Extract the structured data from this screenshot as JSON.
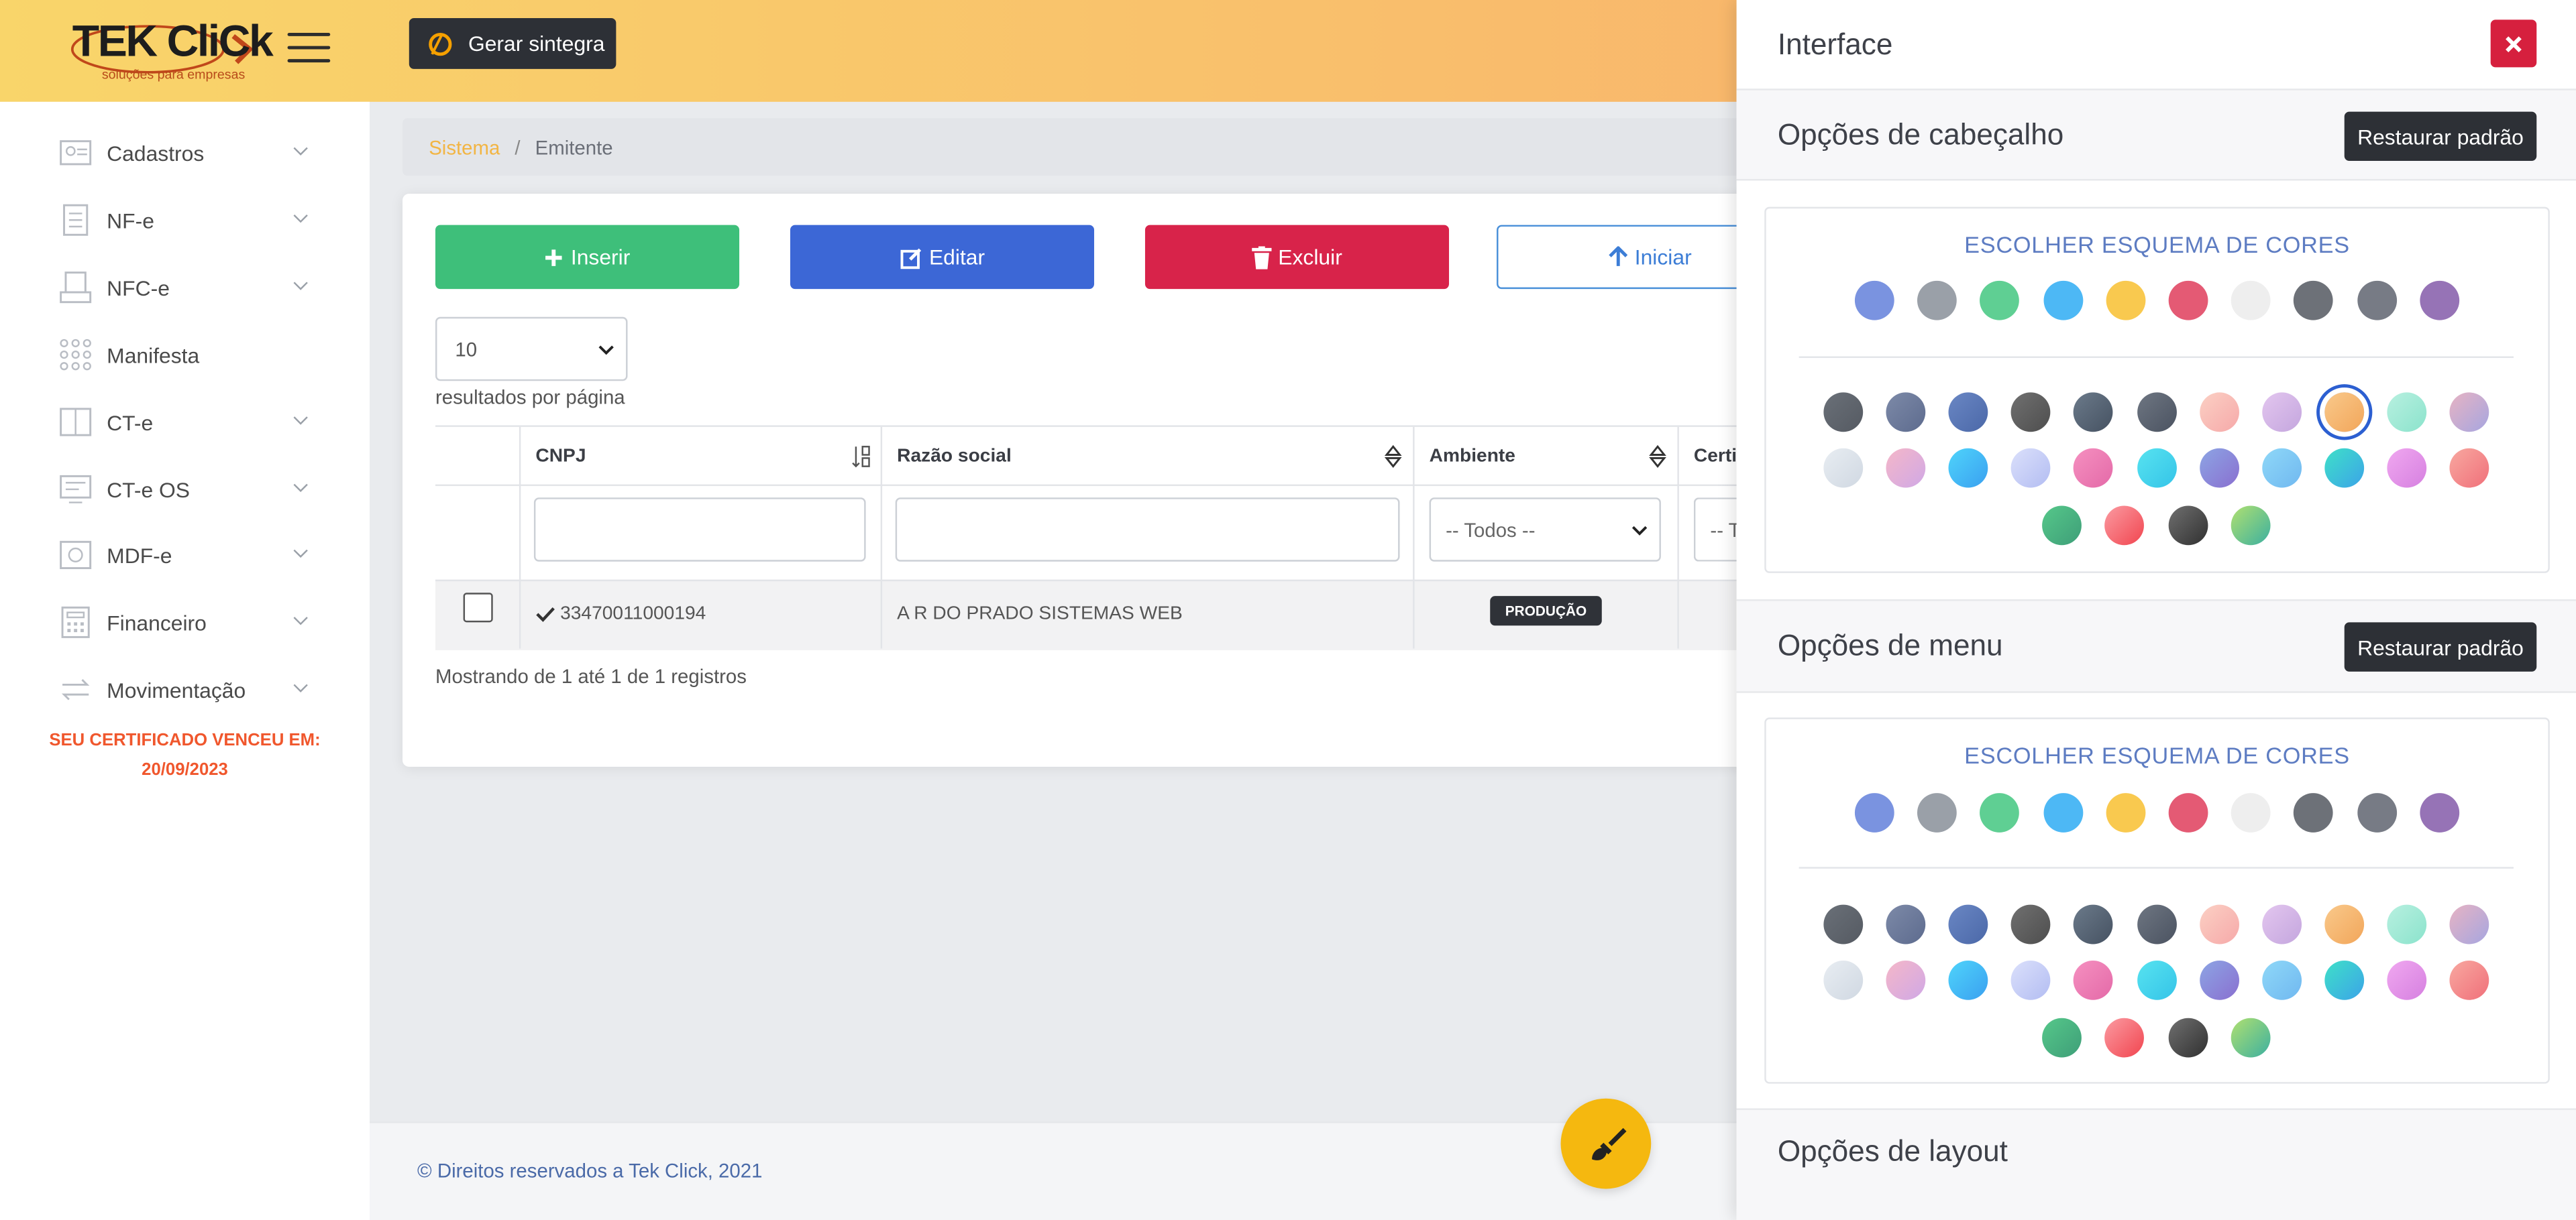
{
  "header": {
    "logo_text": "TEK CliCk",
    "logo_subtitle": "soluções para empresas",
    "generate_button": "Gerar sintegra"
  },
  "sidebar": {
    "items": [
      {
        "label": "Cadastros",
        "icon": "id-card-icon",
        "expandable": true
      },
      {
        "label": "NF-e",
        "icon": "document-icon",
        "expandable": true
      },
      {
        "label": "NFC-e",
        "icon": "receipt-icon",
        "expandable": true
      },
      {
        "label": "Manifesta",
        "icon": "grid-dots-icon",
        "expandable": false
      },
      {
        "label": "CT-e",
        "icon": "book-icon",
        "expandable": true
      },
      {
        "label": "CT-e OS",
        "icon": "monitor-icon",
        "expandable": true
      },
      {
        "label": "MDF-e",
        "icon": "safe-icon",
        "expandable": true
      },
      {
        "label": "Financeiro",
        "icon": "calculator-icon",
        "expandable": true
      },
      {
        "label": "Movimentação",
        "icon": "arrows-exchange-icon",
        "expandable": true
      }
    ],
    "cert_warning_line1": "SEU CERTIFICADO VENCEU EM:",
    "cert_warning_line2": "20/09/2023"
  },
  "breadcrumb": {
    "root": "Sistema",
    "separator": "/",
    "current": "Emitente"
  },
  "actions": {
    "insert": "Inserir",
    "edit": "Editar",
    "delete": "Excluir",
    "start": "Iniciar"
  },
  "pagination": {
    "per_page_value": "10",
    "per_page_label": "resultados por página",
    "showing": "Mostrando de 1 até 1 de 1 registros"
  },
  "table": {
    "columns": [
      "CNPJ",
      "Razão social",
      "Ambiente",
      "Certi"
    ],
    "filters": {
      "ambiente_select": "-- Todos --",
      "cert_select": "-- T"
    },
    "rows": [
      {
        "cnpj": "33470011000194",
        "razao_social": "A R DO PRADO SISTEMAS WEB",
        "ambiente": "PRODUÇÃO"
      }
    ]
  },
  "footer": {
    "copyright": "© Direitos reservados a Tek Click, 2021"
  },
  "interface_panel": {
    "title": "Interface",
    "sections": [
      {
        "title": "Opções de cabeçalho",
        "restore": "Restaurar padrão",
        "scheme_title": "ESCOLHER ESQUEMA DE CORES"
      },
      {
        "title": "Opções de menu",
        "restore": "Restaurar padrão",
        "scheme_title": "ESCOLHER ESQUEMA DE CORES"
      },
      {
        "title": "Opções de layout"
      }
    ],
    "selected_header_color_index": 8
  },
  "colors": {
    "header_gradient_start": "#f9d56a",
    "header_gradient_end": "#f7a86a",
    "insert": "#3ebf7a",
    "edit": "#3c67d6",
    "delete": "#d8234a",
    "start_border": "#4a90d9",
    "accent_yellow": "#f5b80f",
    "close": "#d6203e",
    "cert_warning": "#f0572d",
    "solid_swatches": [
      "#7a93e0",
      "#9aa0a8",
      "#5fcf93",
      "#4db8f5",
      "#f9c94f",
      "#e45a74",
      "#eeeeee",
      "#6d7178",
      "#777b85",
      "#9673b6"
    ],
    "gradient_swatches": [
      [
        "#6a7078",
        "#555a62"
      ],
      [
        "#7d8aa8",
        "#5d6b8e"
      ],
      [
        "#6a87c4",
        "#4b68a8"
      ],
      [
        "#707070",
        "#4e4e4e"
      ],
      [
        "#6b7a8a",
        "#465262"
      ],
      [
        "#6e7682",
        "#4b5361"
      ],
      [
        "#fbd0c4",
        "#f6a9a9"
      ],
      [
        "#e3c6ef",
        "#c4a6de"
      ],
      [
        "#f9c98b",
        "#f2a65a"
      ],
      [
        "#b8f0e0",
        "#8be3cc"
      ],
      [
        "#e7b3c3",
        "#a6a6e0"
      ],
      [
        "#e8edf2",
        "#d0d8e2"
      ],
      [
        "#f5b7c8",
        "#d0a8e6"
      ],
      [
        "#4fd4fb",
        "#3aa0f0"
      ],
      [
        "#dbe0fb",
        "#b3bdf2"
      ],
      [
        "#f590c0",
        "#e46aa8"
      ],
      [
        "#57e3f0",
        "#35c4e8"
      ],
      [
        "#8ca5e4",
        "#8a6fd0"
      ],
      [
        "#8fd8f8",
        "#70b8f0"
      ],
      [
        "#3ee0c8",
        "#3ca4e8"
      ],
      [
        "#f0a8f0",
        "#d680e0"
      ],
      [
        "#f8a8a0",
        "#f0707a"
      ],
      [
        "#56c88a",
        "#3e9e78"
      ],
      [
        "#fb9ba2",
        "#f1454f"
      ],
      [
        "#707070",
        "#303030"
      ],
      [
        "#b0e070",
        "#3cb0a0"
      ]
    ]
  }
}
